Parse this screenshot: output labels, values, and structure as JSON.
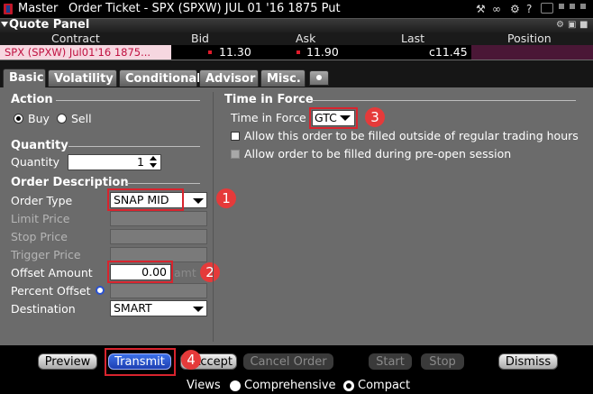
{
  "window": {
    "title_prefix": "Master",
    "title": "Order Ticket - SPX (SPXW) JUL 01 '16 1875 Put",
    "icons": [
      "wrench-icon",
      "link-icon",
      "settings-icon",
      "help-icon",
      "menu-icon"
    ]
  },
  "quote_panel": {
    "title": "Quote Panel",
    "columns": [
      "Contract",
      "Bid",
      "Ask",
      "Last",
      "Position"
    ],
    "row": {
      "contract": "SPX (SPXW) Jul01'16 1875...",
      "bid": "11.30",
      "ask": "11.90",
      "last": "c11.45",
      "position": ""
    }
  },
  "tabs": [
    "Basic",
    "Volatility",
    "Conditional",
    "Advisor",
    "Misc."
  ],
  "action": {
    "title": "Action",
    "buy": "Buy",
    "sell": "Sell",
    "selected": "Buy"
  },
  "quantity": {
    "title": "Quantity",
    "label": "Quantity",
    "value": "1"
  },
  "order_description": {
    "title": "Order Description",
    "order_type_label": "Order Type",
    "order_type_value": "SNAP MID",
    "limit_price_label": "Limit Price",
    "stop_price_label": "Stop Price",
    "trigger_price_label": "Trigger Price",
    "offset_amount_label": "Offset Amount",
    "offset_amount_value": "0.00",
    "offset_unit": "amt",
    "percent_offset_label": "Percent Offset",
    "destination_label": "Destination",
    "destination_value": "SMART"
  },
  "time_in_force": {
    "title": "Time in Force",
    "label": "Time in Force",
    "value": "GTC",
    "outside_rth": "Allow this order to be filled outside of regular trading hours",
    "pre_open": "Allow order to be filled during pre-open session"
  },
  "buttons": {
    "preview": "Preview",
    "transmit": "Transmit",
    "accept": "Accept",
    "cancel_order": "Cancel Order",
    "start": "Start",
    "stop": "Stop",
    "dismiss": "Dismiss"
  },
  "views": {
    "label": "Views",
    "comprehensive": "Comprehensive",
    "compact": "Compact",
    "selected": "Compact"
  },
  "badges": [
    "1",
    "2",
    "3",
    "4"
  ],
  "colors": {
    "highlight": "#d8242e",
    "badge": "#e53a3a",
    "transmit": "#2a52d0"
  }
}
